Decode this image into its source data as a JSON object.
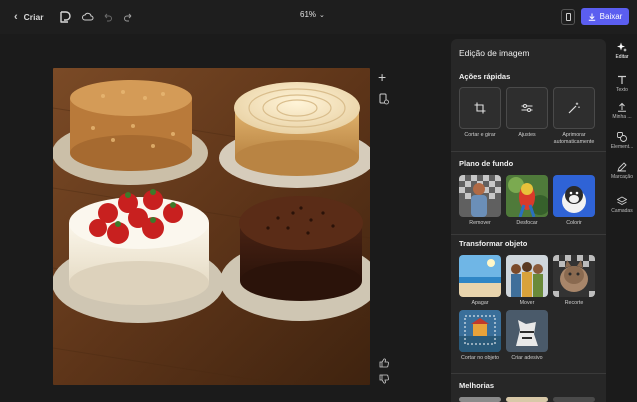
{
  "topbar": {
    "back_label": "Criar",
    "zoom_label": "61%",
    "download_label": "Baixar"
  },
  "panel": {
    "title": "Edição de imagem",
    "quick_actions": {
      "title": "Ações rápidas",
      "items": [
        {
          "label": "Cortar e girar",
          "icon": "crop-icon"
        },
        {
          "label": "Ajustes",
          "icon": "sliders-icon"
        },
        {
          "label": "Aprimorar automaticamente",
          "icon": "magic-wand-icon"
        }
      ]
    },
    "background": {
      "title": "Plano de fundo",
      "items": [
        {
          "label": "Remover"
        },
        {
          "label": "Desfocar"
        },
        {
          "label": "Colorir"
        }
      ]
    },
    "transform": {
      "title": "Transformar objeto",
      "items": [
        {
          "label": "Apagar"
        },
        {
          "label": "Mover"
        },
        {
          "label": "Recorte"
        },
        {
          "label": "Cortar no objeto"
        },
        {
          "label": "Criar adesivo"
        }
      ]
    },
    "improvements": {
      "title": "Melhorias"
    }
  },
  "rail": {
    "items": [
      {
        "label": "Editar",
        "icon": "edit-sparkle-icon"
      },
      {
        "label": "Texto",
        "icon": "text-icon"
      },
      {
        "label": "Minha ...",
        "icon": "upload-icon"
      },
      {
        "label": "Element...",
        "icon": "elements-icon"
      },
      {
        "label": "Marcação",
        "icon": "pen-icon"
      },
      {
        "label": "Camadas",
        "icon": "layers-icon"
      }
    ]
  },
  "colors": {
    "accent": "#5b5ef0",
    "panel_bg": "#272727",
    "app_bg": "#1b1b1b"
  }
}
